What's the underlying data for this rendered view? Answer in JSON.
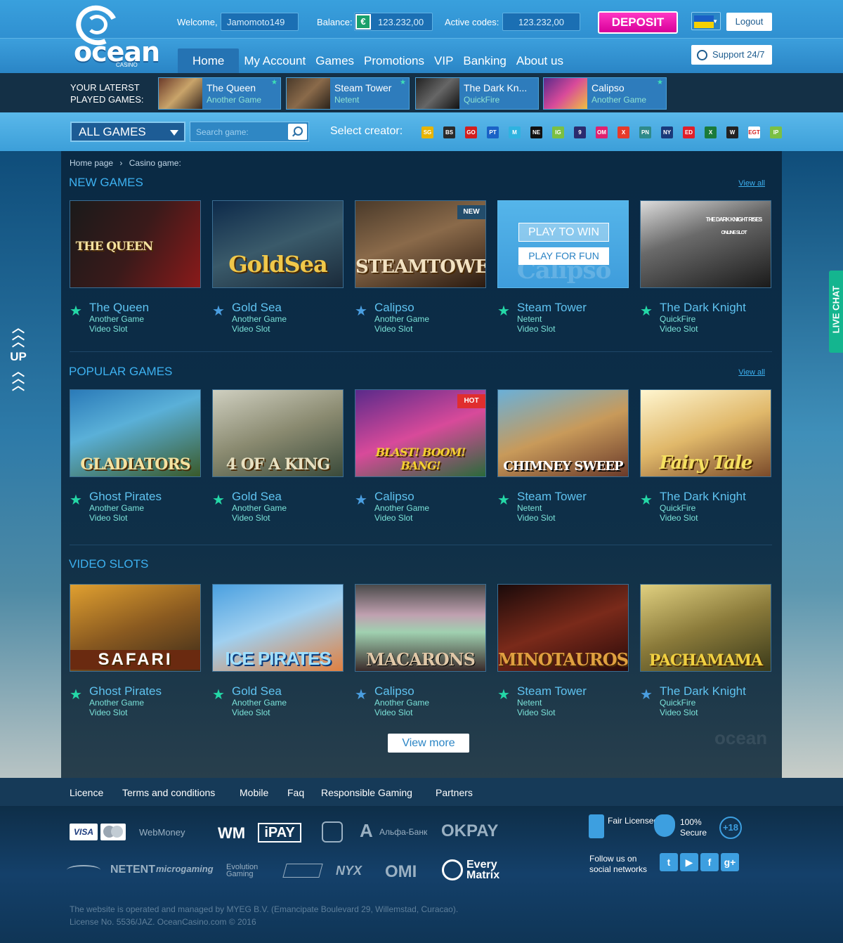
{
  "header": {
    "logo_text": "ocean",
    "logo_sub": "CASINO",
    "welcome_label": "Welcome,",
    "username": "Jamomoto149",
    "balance_label": "Balance:",
    "currency_symbol": "€",
    "balance": "123.232,00",
    "active_codes_label": "Active codes:",
    "active_codes": "123.232,00",
    "deposit": "DEPOSIT",
    "logout": "Logout",
    "support": "Support 24/7"
  },
  "nav": [
    "Home",
    "My Account",
    "Games",
    "Promotions",
    "VIP",
    "Banking",
    "About us"
  ],
  "recent": {
    "title_line1": "YOUR LATERST",
    "title_line2": "PLAYED GAMES:",
    "games": [
      {
        "name": "The Queen",
        "provider": "Another Game"
      },
      {
        "name": "Steam Tower",
        "provider": "Netent"
      },
      {
        "name": "The Dark Kn...",
        "provider": "QuickFire"
      },
      {
        "name": "Calipso",
        "provider": "Another Game"
      }
    ]
  },
  "filter": {
    "all_games": "ALL GAMES",
    "search_placeholder": "Search game:",
    "creator_label": "Select creator:",
    "creators": [
      "SG",
      "BS",
      "GO",
      "PT",
      "M",
      "NE",
      "IG",
      "9",
      "OM",
      "X",
      "PN",
      "NY",
      "ED",
      "X",
      "W",
      "EGT",
      "IP"
    ]
  },
  "breadcrumb": [
    "Home page",
    "Casino game:"
  ],
  "sections": [
    {
      "title": "NEW GAMES",
      "view_all": "View all",
      "games": [
        {
          "name": "The Queen",
          "provider": "Another Game",
          "type": "Video Slot",
          "art": "THE QUEEN"
        },
        {
          "name": "Gold Sea",
          "provider": "Another Game",
          "type": "Video Slot",
          "art": "GoldSea"
        },
        {
          "name": "Calipso",
          "provider": "Another Game",
          "type": "Video Slot",
          "art": "STEAMTOWER",
          "badge": "NEW"
        },
        {
          "name": "Steam Tower",
          "provider": "Netent",
          "type": "Video Slot",
          "art": "Calipso",
          "play_win": "PLAY TO WIN",
          "play_fun": "PLAY FOR FUN"
        },
        {
          "name": "The Dark Knight",
          "provider": "QuickFire",
          "type": "Video Slot",
          "art": "THE DARK KNIGHT RISES",
          "art_sub": "ONLINE SLOT"
        }
      ]
    },
    {
      "title": "POPULAR GAMES",
      "view_all": "View all",
      "games": [
        {
          "name": "Ghost Pirates",
          "provider": "Another Game",
          "type": "Video Slot",
          "art": "GLADIATORS"
        },
        {
          "name": "Gold Sea",
          "provider": "Another Game",
          "type": "Video Slot",
          "art": "4 OF A KING"
        },
        {
          "name": "Calipso",
          "provider": "Another Game",
          "type": "Video Slot",
          "art": "BLAST! BOOM! BANG!",
          "badge": "HOT"
        },
        {
          "name": "Steam Tower",
          "provider": "Netent",
          "type": "Video Slot",
          "art": "CHIMNEY SWEEP"
        },
        {
          "name": "The Dark Knight",
          "provider": "QuickFire",
          "type": "Video Slot",
          "art": "Fairy Tale"
        }
      ]
    },
    {
      "title": "VIDEO SLOTS",
      "games": [
        {
          "name": "Ghost Pirates",
          "provider": "Another Game",
          "type": "Video Slot",
          "art": "SAFARI"
        },
        {
          "name": "Gold Sea",
          "provider": "Another Game",
          "type": "Video Slot",
          "art": "ICE PIRATES"
        },
        {
          "name": "Calipso",
          "provider": "Another Game",
          "type": "Video Slot",
          "art": "MACARONS"
        },
        {
          "name": "Steam Tower",
          "provider": "Netent",
          "type": "Video Slot",
          "art": "MINOTAUROS"
        },
        {
          "name": "The Dark Knight",
          "provider": "QuickFire",
          "type": "Video Slot",
          "art": "PACHAMAMA"
        }
      ]
    }
  ],
  "view_more": "View more",
  "up": "UP",
  "live_chat": "LIVE CHAT",
  "footer_nav": [
    "Licence",
    "Terms and conditions",
    "Mobile",
    "Faq",
    "Responsible Gaming",
    "Partners"
  ],
  "payments": {
    "visa": "VISA",
    "webmoney": "WebMoney",
    "wm": "WM",
    "ipay": "iPAY",
    "alfa": "Альфа-Банк",
    "okpay": "OKPAY"
  },
  "providers": [
    "NETENT",
    "microgaming",
    "Evolution Gaming",
    "NYX",
    "OMI",
    "Every Matrix"
  ],
  "badges": {
    "fair": "Fair Licensed",
    "secure": "100% Secure",
    "age": "+18"
  },
  "follow": "Follow us on social networks",
  "social": [
    "t",
    "▶",
    "f",
    "g+"
  ],
  "copyright_line1": "The website is operated and managed by MYEG B.V. (Emancipate Boulevard 29, Willemstad, Curacao).",
  "copyright_line2": "License No. 5536/JAZ. OceanCasino.com © 2016",
  "colors": {
    "accent": "#3db1f0",
    "deposit": "#e91fb2",
    "live_chat": "#14b58f",
    "star": "#24d8a7"
  }
}
